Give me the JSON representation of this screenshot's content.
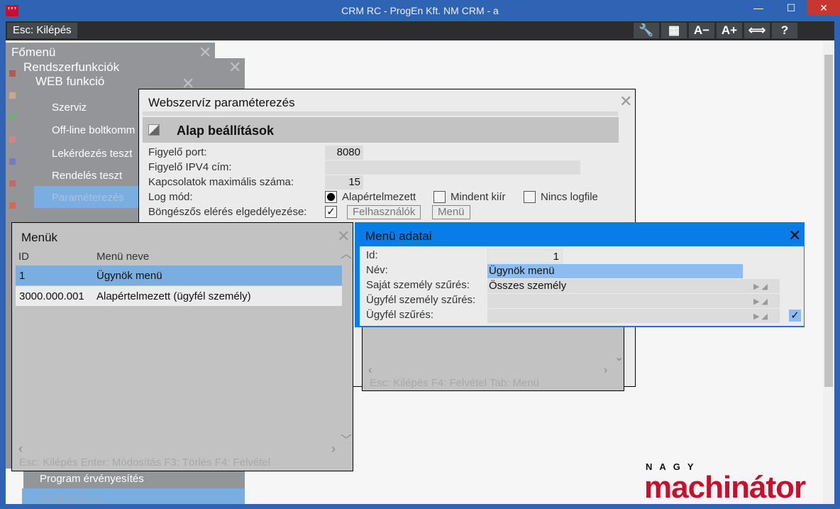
{
  "window": {
    "title": "CRM RC - ProgEn Kft. NM CRM - a",
    "minimize": "—",
    "maximize": "☐",
    "close": "✕"
  },
  "toolbar": {
    "esc_label": "Esc: Kilépés",
    "icons": [
      "wrench-icon",
      "grid-icon",
      "font-decrease-icon",
      "font-increase-icon",
      "resize-icon",
      "help-icon"
    ],
    "glyphs": [
      "🔧",
      "▦",
      "A−",
      "A+",
      "⟺",
      "?"
    ]
  },
  "menus": {
    "main": "Főmenü",
    "system": "Rendszerfunkciók",
    "web": "WEB funkció",
    "items": [
      "Szerviz",
      "Off-line boltkomm",
      "Lekérdezés teszt",
      "Rendelés teszt",
      "Paraméterezés"
    ],
    "bottom_items": [
      "Program érvényesítés",
      "WEB funkció"
    ]
  },
  "webservice": {
    "title": "Webszervíz paraméterezés",
    "section": "Alap beállítások",
    "port_label": "Figyelő port:",
    "port": "8080",
    "ip_label": "Figyelő IPV4 cím:",
    "ip": "",
    "maxconn_label": "Kapcsolatok maximális száma:",
    "maxconn": "15",
    "log_label": "Log mód:",
    "log_options": [
      "Alapértelmezett",
      "Mindent kiír",
      "Nincs logfile"
    ],
    "log_selected": "Alapértelmezett",
    "browser_label": "Böngészős elérés elgedélyezése:",
    "browser_checked": "✓",
    "users_btn": "Felhasználók",
    "menu_btn": "Menü"
  },
  "menu_list": {
    "title": "Menük",
    "columns": [
      "ID",
      "Menü neve"
    ],
    "rows": [
      {
        "id": "1",
        "name": "Ügynök menü"
      },
      {
        "id": "3000.000.001",
        "name": "Alapértelmezett (ügyfél személy)"
      }
    ],
    "footer": "Esc: Kilépés  Enter: Módosítás  F3: Törlés  F4: Felvétel"
  },
  "menu_detail": {
    "title": "Menü adatai",
    "id_label": "Id:",
    "id": "1",
    "name_label": "Név:",
    "name": "Ügynök menü",
    "own_filter_label": "Saját személy szűrés:",
    "own_filter": "Összes személy",
    "client_person_label": "Ügyfél személy szűrés:",
    "client_person": "",
    "client_label": "Ügyfél szűrés:",
    "client": "",
    "client_checked": "✓",
    "behind_footer": "Esc: Kilépés  F4: Felvétel  Tab: Menü"
  },
  "logo": {
    "top": "NAGY",
    "brand": "machinátor"
  }
}
